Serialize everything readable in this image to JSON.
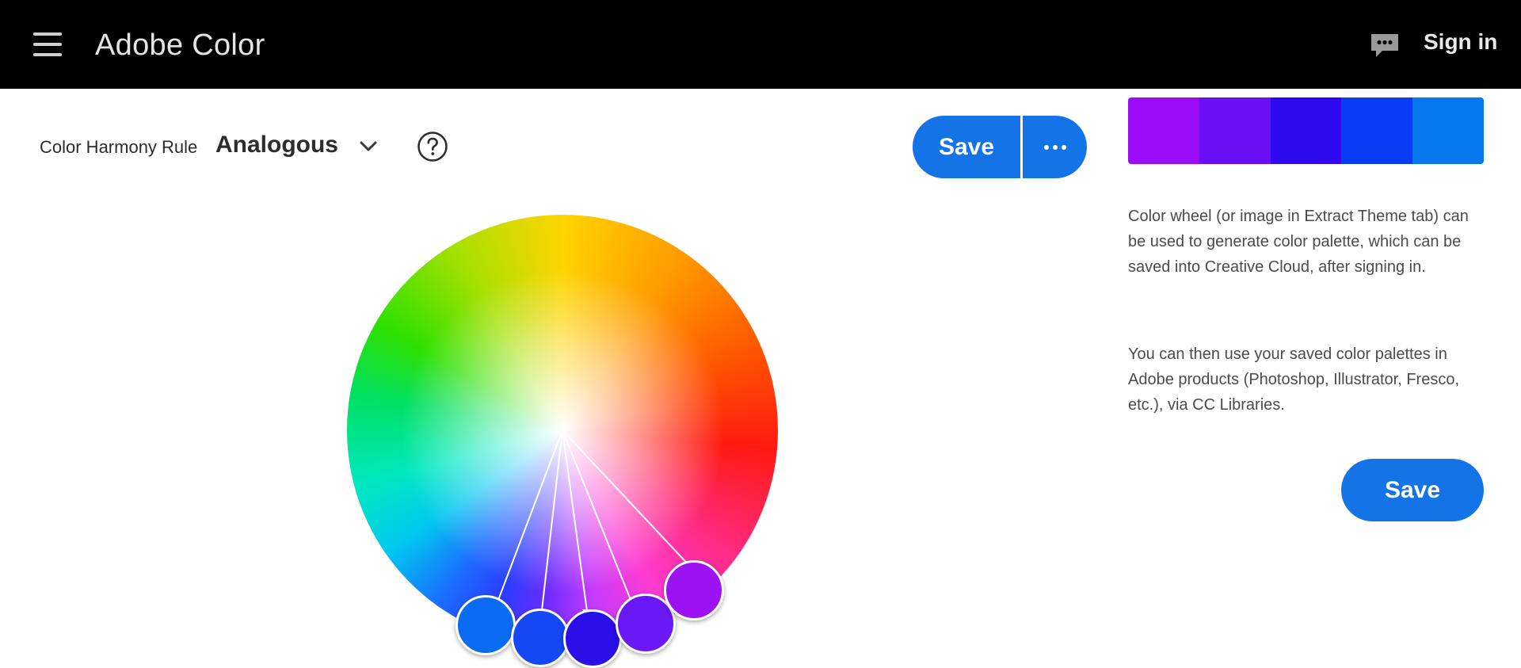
{
  "app": {
    "title": "Adobe Color",
    "sign_in_label": "Sign in",
    "menu_icon": "hamburger-icon",
    "feedback_icon": "feedback-icon"
  },
  "harmony": {
    "label": "Color Harmony Rule",
    "value": "Analogous",
    "dropdown_icon": "chevron-down-icon",
    "help_icon": "help-icon"
  },
  "toolbar": {
    "save_label": "Save",
    "more_icon": "more-icon"
  },
  "palette": {
    "swatches": [
      "#9b0bf5",
      "#6a0ff4",
      "#2f0af0",
      "#0a3cf5",
      "#0878ef"
    ]
  },
  "description": {
    "paragraph1": "Color wheel (or image in Extract Theme tab) can be used to generate color palette, which can be saved into Creative Cloud, after signing in.",
    "paragraph2": "You can then use your saved color palettes in Adobe products (Photoshop, Illustrator, Fresco, etc.), via CC Libraries."
  },
  "sidebar_save_label": "Save",
  "wheel": {
    "harmony_handles": [
      "#0a6cf2",
      "#1448f5",
      "#2a10e8",
      "#6a18f5",
      "#9d12f2"
    ],
    "base_handle_index": 2
  },
  "colors": {
    "accent": "#1473e6",
    "topbar": "#000000"
  }
}
